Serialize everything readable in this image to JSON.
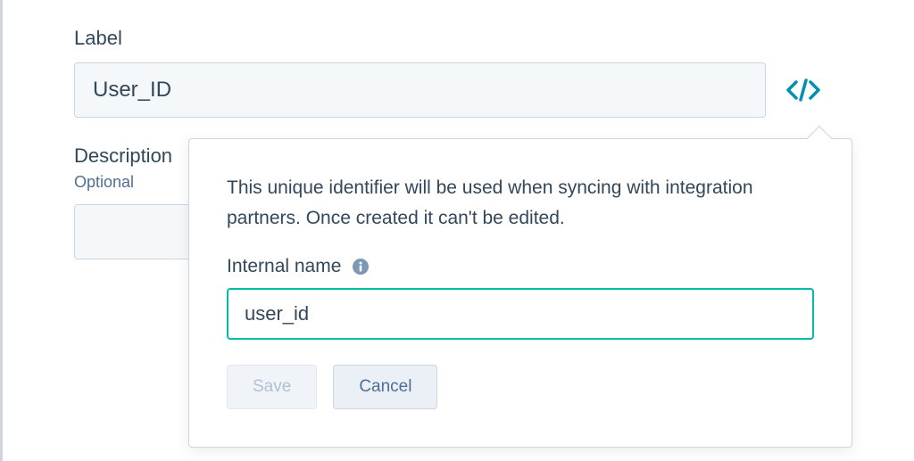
{
  "form": {
    "label_label": "Label",
    "label_value": "User_ID",
    "description_label": "Description",
    "optional_text": "Optional",
    "description_value": ""
  },
  "popover": {
    "help_text": "This unique identifier will be used when syncing with integration partners. Once created it can't be edited.",
    "internal_name_label": "Internal name",
    "internal_name_value": "user_id",
    "save_label": "Save",
    "cancel_label": "Cancel"
  }
}
